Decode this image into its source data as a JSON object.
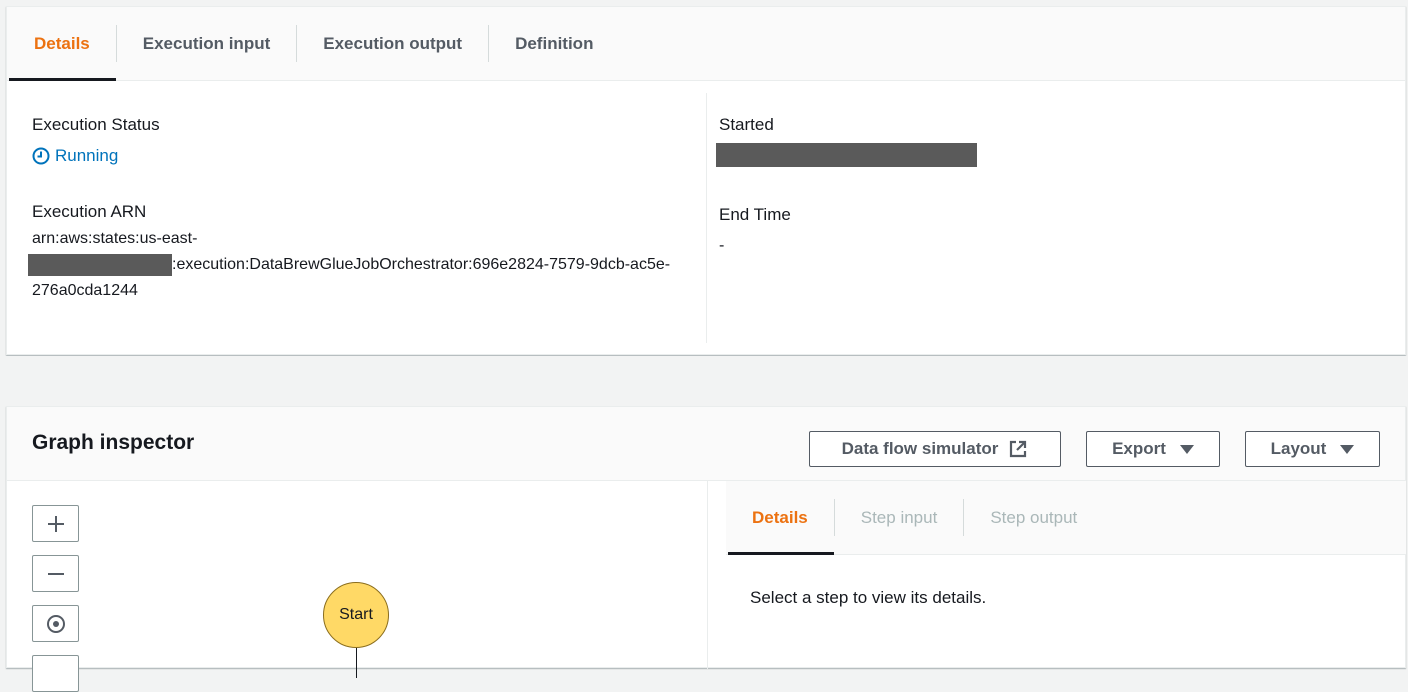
{
  "details_tabs": [
    {
      "label": "Details",
      "active": true
    },
    {
      "label": "Execution input",
      "active": false
    },
    {
      "label": "Execution output",
      "active": false
    },
    {
      "label": "Definition",
      "active": false
    }
  ],
  "execution": {
    "status_label": "Execution Status",
    "status_value": "Running",
    "status_icon": "clock-icon",
    "arn_label": "Execution ARN",
    "arn_prefix": "arn:aws:states:us-east-",
    "arn_suffix": ":execution:DataBrewGlueJobOrchestrator:696e2824-7579-9dcb-ac5e-276a0cda1244",
    "started_label": "Started",
    "end_time_label": "End Time",
    "end_time_value": "-"
  },
  "graph_inspector": {
    "title": "Graph inspector",
    "buttons": {
      "data_flow_simulator": "Data flow simulator",
      "export": "Export",
      "layout": "Layout"
    },
    "start_node_label": "Start",
    "inspector_tabs": [
      {
        "label": "Details",
        "active": true
      },
      {
        "label": "Step input",
        "active": false
      },
      {
        "label": "Step output",
        "active": false
      }
    ],
    "empty_message": "Select a step to view its details."
  },
  "colors": {
    "accent_orange": "#ec7211",
    "link_blue": "#0073bb",
    "start_node": "#ffd966"
  }
}
